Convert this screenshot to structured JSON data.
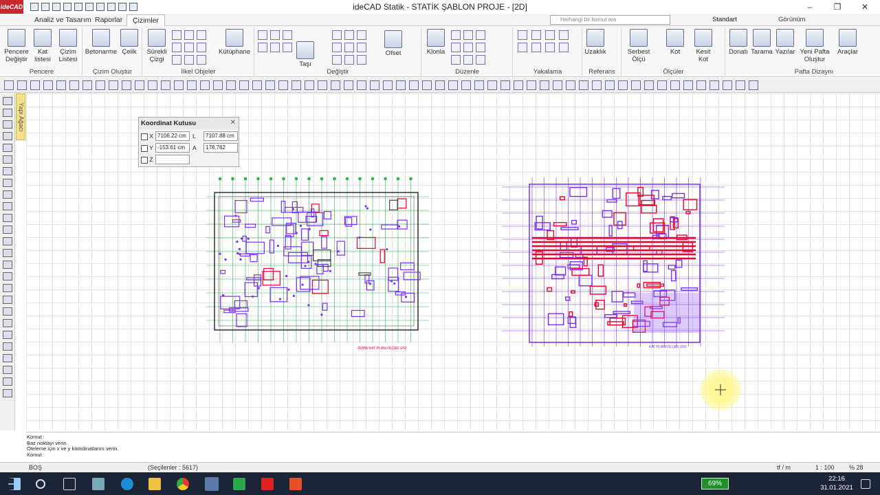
{
  "app": {
    "logo": "ideCAD",
    "title": "ideCAD Statik - STATİK ŞABLON PROJE - [2D]"
  },
  "tabs": [
    "Analiz ve Tasarım",
    "Raporlar",
    "Çizimler"
  ],
  "search": {
    "placeholder": "Herhangi bir komut ara"
  },
  "style_select": "Standart",
  "view_menu": "Görünüm",
  "ribbon": {
    "groups": [
      {
        "label": "Pencere",
        "buttons": [
          "Pencere Değiştir",
          "Kat listesi",
          "Çizim Listesi"
        ]
      },
      {
        "label": "Çizim Oluştur",
        "buttons": [
          "Betonarme",
          "Çelik"
        ]
      },
      {
        "label": "İlkel Objeler",
        "buttons": [
          "Sürekli Çizgi",
          "Kütüphane"
        ]
      },
      {
        "label": "Değiştir",
        "buttons": [
          "Taşı",
          "Ofset"
        ]
      },
      {
        "label": "Düzenle",
        "buttons": [
          "Klonla"
        ]
      },
      {
        "label": "Yakalama",
        "buttons": []
      },
      {
        "label": "Referans",
        "buttons": [
          "Uzaklık"
        ]
      },
      {
        "label": "Ölçüler",
        "buttons": [
          "Serbest Ölçü",
          "Kot",
          "Kesit Kot"
        ]
      },
      {
        "label": "Pafta Dizaynı",
        "buttons": [
          "Donatı",
          "Tarama",
          "Yazılar",
          "Yeni Pafta Oluştur",
          "Araçlar"
        ]
      }
    ]
  },
  "side_tab": "Yapı Ağacı",
  "coord_box": {
    "title": "Koordinat Kutusu",
    "x_label": "X",
    "x_value": "7106.22 cm",
    "y_label": "Y",
    "y_value": "-153.61 cm",
    "z_label": "Z",
    "z_value": "",
    "l_label": "L",
    "l_value": "7107.88 cm",
    "a_label": "A",
    "a_value": "178.762"
  },
  "plans": [
    {
      "caption": "ZEMİN KAT PLANI ÖLÇEK 1/50"
    },
    {
      "caption": "KAT PLANI ÖLÇEK 1/50"
    }
  ],
  "command_log": [
    "Komut :",
    "Baz noktayı verin.",
    "Öteleme için x ve y koordinatlarını verin.",
    "Komut :"
  ],
  "status": {
    "mode": "BOŞ",
    "selection": "(Seçilenler : 5617)",
    "units": "tf / m",
    "scale": "1 : 100",
    "zoom": "% 28"
  },
  "taskbar": {
    "battery": "69%",
    "time": "22:16",
    "date": "31.01.2021"
  },
  "colors": {
    "accent": "#c8272c",
    "plan_purple": "#7b2ff7",
    "plan_red": "#e8002a",
    "plan_green": "#2fb24a",
    "taskbar": "#1c2536"
  }
}
